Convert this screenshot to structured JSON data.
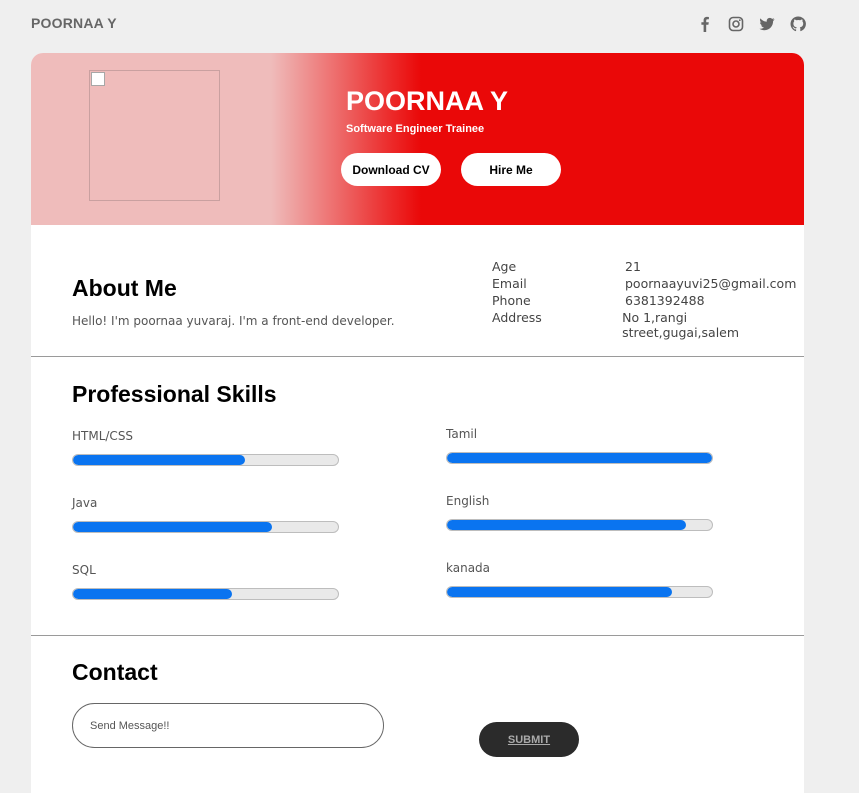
{
  "header": {
    "brand": "POORNAA Y",
    "social_icons": [
      "facebook-icon",
      "instagram-icon",
      "twitter-icon",
      "github-icon"
    ]
  },
  "hero": {
    "name": "POORNAA Y",
    "role": "Software Engineer Trainee",
    "download_cv_label": "Download CV",
    "hire_me_label": "Hire Me"
  },
  "about": {
    "title": "About Me",
    "text": "Hello! I'm poornaa yuvaraj. I'm a front-end developer.",
    "info": [
      {
        "key": "Age",
        "value": "21"
      },
      {
        "key": "Email",
        "value": "poornaayuvi25@gmail.com"
      },
      {
        "key": "Phone",
        "value": "6381392488"
      },
      {
        "key": "Address",
        "value": "No 1,rangi street,gugai,salem"
      }
    ]
  },
  "skills": {
    "title": "Professional Skills",
    "left": [
      {
        "label": "HTML/CSS",
        "level": 0.65
      },
      {
        "label": "Java",
        "level": 0.75
      },
      {
        "label": "SQL",
        "level": 0.6
      }
    ],
    "right": [
      {
        "label": "Tamil",
        "level": 1.0
      },
      {
        "label": "English",
        "level": 0.9
      },
      {
        "label": "kanada",
        "level": 0.85
      }
    ]
  },
  "contact": {
    "title": "Contact",
    "message_placeholder": "Send Message!!",
    "submit_label": "SUBMIT"
  },
  "colors": {
    "accent_red": "#ea0808",
    "hero_pink": "#efbcbb",
    "skill_blue": "#0a74f0"
  }
}
